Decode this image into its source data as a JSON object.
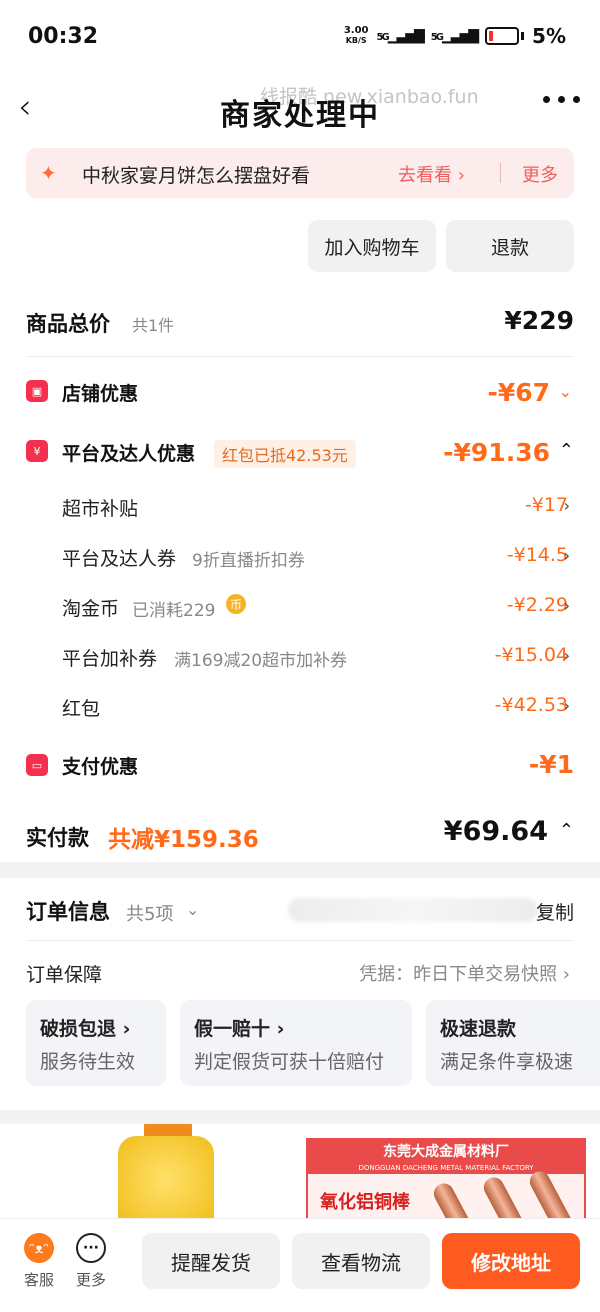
{
  "status_bar": {
    "time": "00:32",
    "net_speed": "3.00",
    "net_unit": "KB/S",
    "sig1": "5G",
    "sig2": "5G",
    "battery": "5%"
  },
  "nav": {
    "title": "商家处理中",
    "watermark": "线报酷 new.xianbao.fun"
  },
  "promo": {
    "text": "中秋家宴月饼怎么摆盘好看",
    "go": "去看看 ›",
    "more": "更多"
  },
  "actions": {
    "add_cart": "加入购物车",
    "refund": "退款"
  },
  "summary": {
    "total_label": "商品总价",
    "total_count": "共1件",
    "total_value": "¥229",
    "store_discount_label": "店铺优惠",
    "store_discount_value": "-¥67",
    "platform_label": "平台及达人优惠",
    "platform_tag": "红包已抵42.53元",
    "platform_value": "-¥91.36",
    "items": [
      {
        "label": "超市补贴",
        "note": "",
        "value": "-¥17"
      },
      {
        "label": "平台及达人券",
        "note": "9折直播折扣券",
        "value": "-¥14.5"
      },
      {
        "label": "淘金币",
        "note": "已消耗229",
        "value": "-¥2.29"
      },
      {
        "label": "平台加补券",
        "note": "满169减20超市加补券",
        "value": "-¥15.04"
      },
      {
        "label": "红包",
        "note": "",
        "value": "-¥42.53"
      }
    ],
    "pay_discount_label": "支付优惠",
    "pay_discount_value": "-¥1",
    "actual_label": "实付款",
    "actual_saved": "共减¥159.36",
    "actual_value": "¥69.64"
  },
  "order_info": {
    "title": "订单信息",
    "count": "共5项",
    "copy": "复制"
  },
  "guarantee": {
    "title": "订单保障",
    "evidence": "凭据：昨日下单交易快照 ›",
    "cards": [
      {
        "title": "破损包退 ›",
        "sub": "服务待生效"
      },
      {
        "title": "假一赔十 ›",
        "sub": "判定假货可获十倍赔付"
      },
      {
        "title": "极速退款",
        "sub": "满足条件享极速"
      }
    ]
  },
  "ad": {
    "company": "东莞大成金属材料厂",
    "company_en": "DONGGUAN DACHENG METAL MATERIAL FACTORY",
    "product": "氧化铝铜棒"
  },
  "bottom_bar": {
    "service": "客服",
    "more": "更多",
    "remind": "提醒发货",
    "logistics": "查看物流",
    "change_address": "修改地址"
  },
  "colors": {
    "accent": "#ff6a1a",
    "cta": "#ff5a1f",
    "red_icon": "#f5304e"
  }
}
